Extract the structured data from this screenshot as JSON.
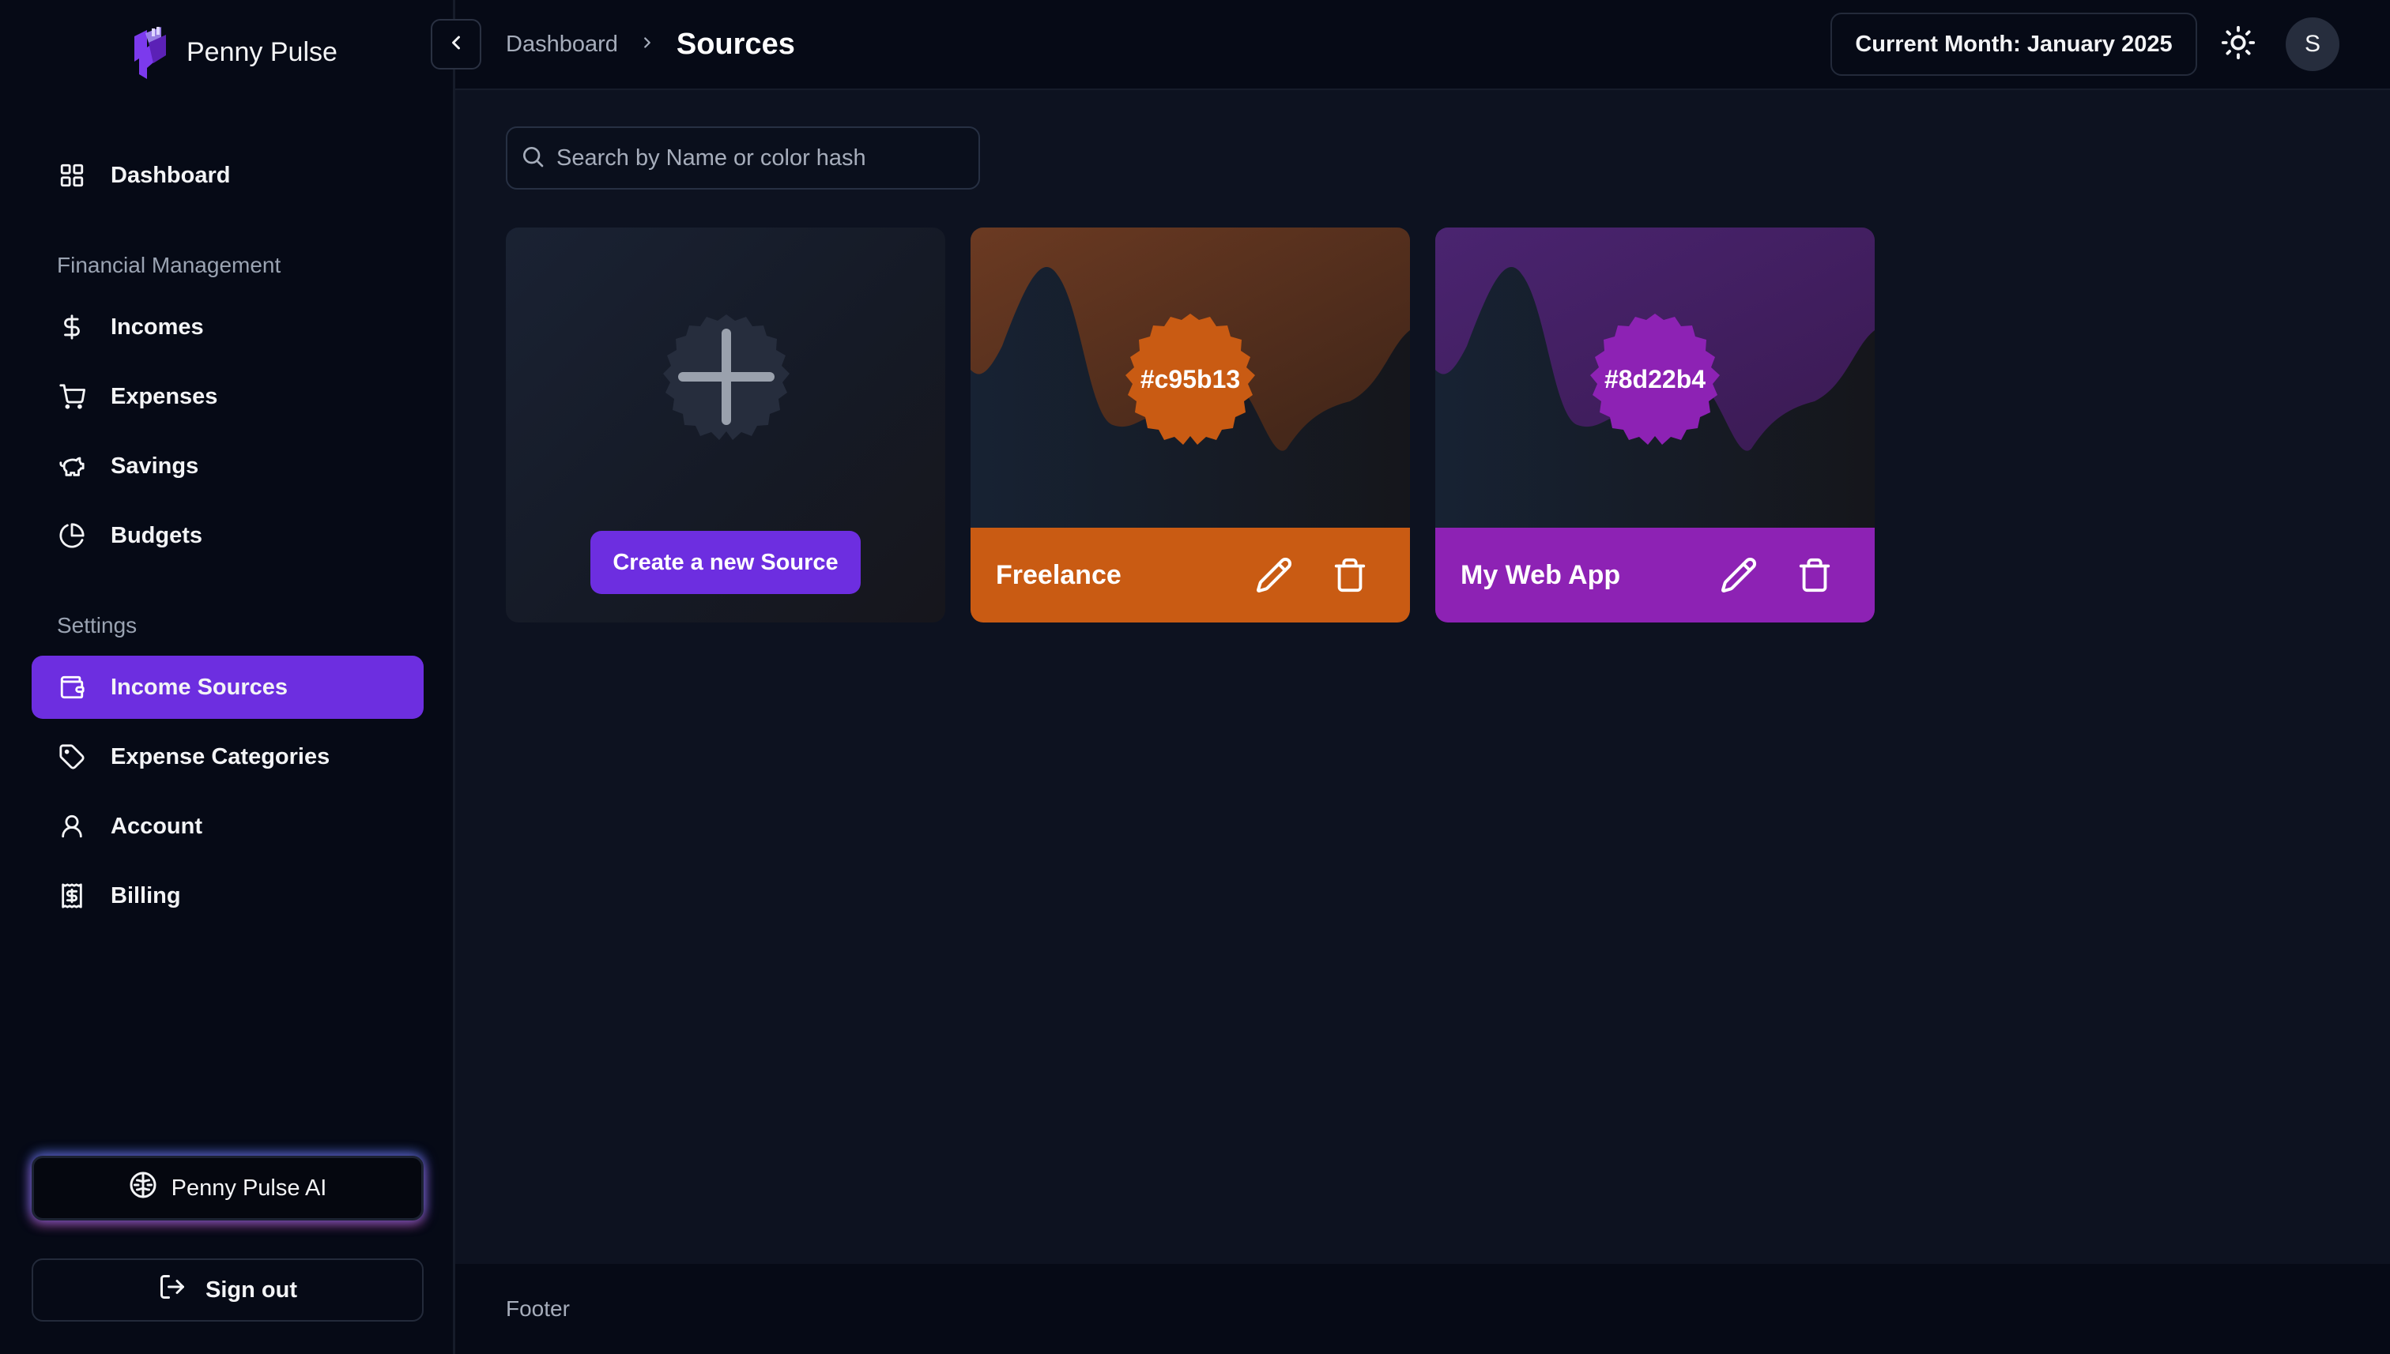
{
  "app": {
    "name": "Penny Pulse"
  },
  "sidebar": {
    "dashboard": {
      "label": "Dashboard",
      "icon": "grid-icon"
    },
    "sections": [
      {
        "title": "Financial Management",
        "items": [
          {
            "label": "Incomes",
            "icon": "dollar-icon"
          },
          {
            "label": "Expenses",
            "icon": "cart-icon"
          },
          {
            "label": "Savings",
            "icon": "piggy-bank-icon"
          },
          {
            "label": "Budgets",
            "icon": "pie-chart-icon"
          }
        ]
      },
      {
        "title": "Settings",
        "items": [
          {
            "label": "Income Sources",
            "icon": "wallet-icon",
            "active": true
          },
          {
            "label": "Expense Categories",
            "icon": "tag-icon"
          },
          {
            "label": "Account",
            "icon": "user-icon"
          },
          {
            "label": "Billing",
            "icon": "receipt-icon"
          }
        ]
      }
    ],
    "ai_button": "Penny Pulse AI",
    "signout_button": "Sign out"
  },
  "header": {
    "breadcrumb_parent": "Dashboard",
    "breadcrumb_current": "Sources",
    "current_month": "Current Month: January 2025",
    "avatar_initial": "S"
  },
  "search": {
    "placeholder": "Search by Name or color hash",
    "value": ""
  },
  "create_card": {
    "button_label": "Create a new Source"
  },
  "sources": [
    {
      "name": "Freelance",
      "color": "#c95b13",
      "hash_label": "#c95b13"
    },
    {
      "name": "My Web App",
      "color": "#8d22b4",
      "hash_label": "#8d22b4"
    }
  ],
  "footer": {
    "text": "Footer"
  },
  "colors": {
    "accent": "#6d2ee0",
    "background": "#0d1220",
    "sidebar": "#060a16"
  }
}
